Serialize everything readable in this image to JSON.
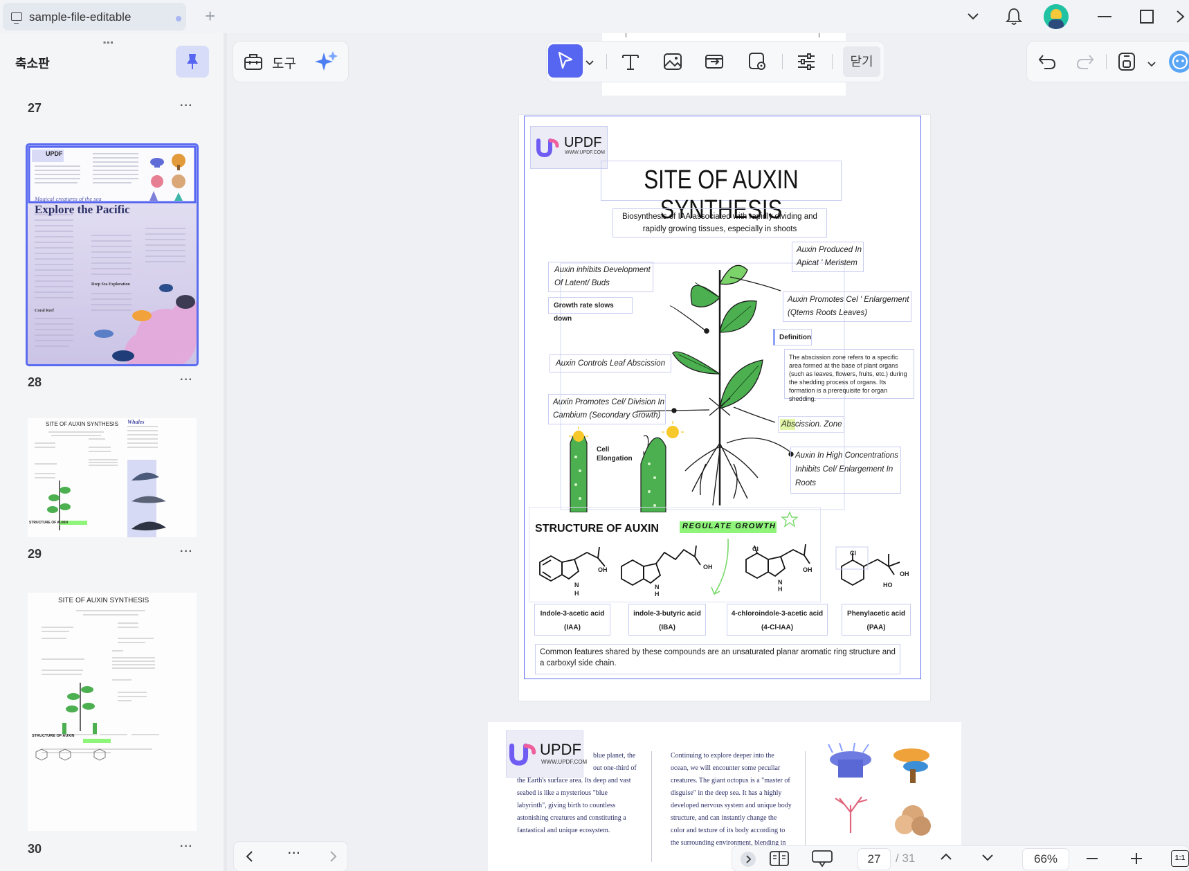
{
  "window": {
    "tab_title": "sample-file-editable"
  },
  "sidebar": {
    "title": "축소판",
    "pages": [
      {
        "number": "27",
        "more": "···"
      },
      {
        "number": "28",
        "more": "···"
      },
      {
        "number": "29",
        "more": "···"
      },
      {
        "number": "30",
        "more": "···"
      }
    ],
    "thumb28": {
      "logo": "UPDF",
      "section": "Magical creatures of the sea",
      "heading": "Explore the Pacific",
      "sub1": "Deep Sea Exploration",
      "sub2": "Coral Reef"
    },
    "thumb29": {
      "title": "SITE OF AUXIN SYNTHESIS",
      "side": "Whales",
      "structure": "STRUCTURE OF AUXIN"
    },
    "thumb30": {
      "title": "SITE OF AUXIN SYNTHESIS",
      "structure": "STRUCTURE OF AUXIN"
    }
  },
  "toolbar": {
    "tools_label": "도구",
    "close_label": "닫기"
  },
  "doc": {
    "logo_text": "UPDF",
    "logo_url": "WWW.UPDF.COM",
    "title": "SITE OF AUXIN SYNTHESIS",
    "subtitle": "Biosynthesis of IAA associated with rapidly dividing and rapidly growing tissues, especially in shoots",
    "labels": {
      "inhibits": "Auxin inhibits Development Of Latent/ Buds",
      "growth_slows": "Growth rate slows down",
      "produced": "Auxin Produced In Apicat ' Meristem",
      "promotes_enlarge": "Auxin Promotes Cel ' Enlargement (Qtems Roots Leaves)",
      "definition_title": "Definition",
      "definition_text": "The abscission zone refers to a specific area formed at the base of plant organs (such as leaves, flowers, fruits, etc.) during the shedding process of organs. Its formation is a prerequisite for organ shedding.",
      "leaf_abscission": "Auxin Controls Leaf Abscission",
      "promotes_division": "Auxin Promotes Cel/ Division In Cambium (Secondary Growth)",
      "abscission_zone": "Abscission. Zone",
      "cell_elongation": "Cell Elongation",
      "high_conc": "Auxin In High Concentrations Inhibits Cel/ Enlargement In Roots"
    },
    "structure_title": "STRUCTURE OF AUXIN",
    "regulate": "REGULATE GROWTH",
    "compounds": [
      {
        "name": "Indole-3-acetic acid",
        "abbr": "(IAA)"
      },
      {
        "name": "indole-3-butyric acid",
        "abbr": "(IBA)"
      },
      {
        "name": "4-chloroindole-3-acetic acid",
        "abbr": "(4-Cl-IAA)"
      },
      {
        "name": "Phenylacetic acid",
        "abbr": "(PAA)"
      }
    ],
    "chem": {
      "oh": "OH",
      "h": "H",
      "n": "N",
      "cl": "Cl",
      "ho": "HO"
    },
    "footer_note": "Common features shared by these compounds are an unsaturated planar aromatic ring structure and a carboxyl side chain."
  },
  "next_page": {
    "logo_text": "UPDF",
    "logo_url": "WWW.UPDF.COM",
    "col1_lines": [
      "blue planet, the",
      "out one-third of",
      "the Earth's surface area. Its deep and vast",
      "seabed is like a mysterious \"blue",
      "labyrinth\", giving birth to countless",
      "astonishing creatures and constituting a",
      "fantastical and unique ecosystem."
    ],
    "col2_lines": [
      "Continuing to explore deeper into the",
      "ocean, we will encounter some peculiar",
      "creatures. The giant octopus is a \"master of",
      "disguise\" in the deep sea. It has a highly",
      "developed nervous system and unique body",
      "structure, and can instantly change the",
      "color and texture of its body according to",
      "the surrounding environment, blending in"
    ]
  },
  "nav": {
    "more": "···"
  },
  "status": {
    "current_page": "27",
    "total_pages": "/ 31",
    "zoom": "66%",
    "fit": "1:1"
  },
  "colors": {
    "accent": "#5766f0",
    "selection": "#5d6bf0",
    "leaf_green": "#4caf50",
    "highlight_green": "#8ef57a"
  }
}
